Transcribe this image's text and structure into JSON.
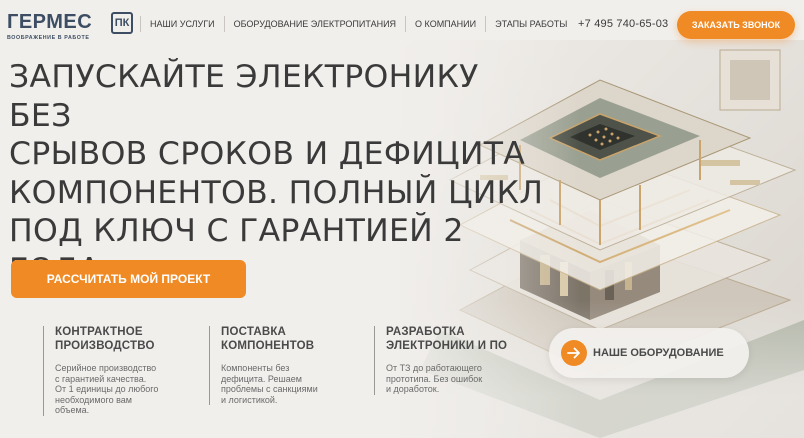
{
  "logo": {
    "word": "ГЕРМЕС",
    "badge": "ПК",
    "tagline": "ВООБРАЖЕНИЕ В РАБОТЕ"
  },
  "nav": {
    "items": [
      {
        "label": "НАШИ УСЛУГИ"
      },
      {
        "label": "ОБОРУДОВАНИЕ ЭЛЕКТРОПИТАНИЯ"
      },
      {
        "label": "О КОМПАНИИ"
      },
      {
        "label": "ЭТАПЫ РАБОТЫ"
      }
    ]
  },
  "header": {
    "phone": "+7 495 740-65-03",
    "call_label": "ЗАКАЗАТЬ ЗВОНОК"
  },
  "hero": {
    "headline_lines": [
      "ЗАПУСКАЙТЕ ЭЛЕКТРОНИКУ БЕЗ",
      "СРЫВОВ СРОКОВ И ДЕФИЦИТА",
      "КОМПОНЕНТОВ. ПОЛНЫЙ ЦИКЛ",
      "ПОД КЛЮЧ С ГАРАНТИЕЙ 2",
      "ГОДА."
    ],
    "cta_label": "РАССЧИТАТЬ МОЙ ПРОЕКТ"
  },
  "features": [
    {
      "title_lines": [
        "КОНТРАКТНОЕ",
        "ПРОИЗВОДСТВО"
      ],
      "desc_lines": [
        "Серийное производство",
        "с гарантией качества.",
        "От 1 единицы до любого",
        "необходимого вам",
        "объема."
      ]
    },
    {
      "title_lines": [
        "ПОСТАВКА",
        "КОМПОНЕНТОВ"
      ],
      "desc_lines": [
        "Компоненты без",
        "дефицита. Решаем",
        "проблемы с санкциями",
        "и логистикой."
      ]
    },
    {
      "title_lines": [
        "РАЗРАБОТКА",
        "ЭЛЕКТРОНИКИ И ПО"
      ],
      "desc_lines": [
        "От ТЗ до работающего",
        "прототипа. Без ошибок",
        "и доработок."
      ]
    }
  ],
  "equipment": {
    "label": "НАШЕ ОБОРУДОВАНИЕ",
    "icon": "arrow-right-icon"
  },
  "colors": {
    "accent": "#f08a24",
    "background": "#f1efec",
    "text": "#3a3a3a",
    "logo": "#3d4d63"
  }
}
